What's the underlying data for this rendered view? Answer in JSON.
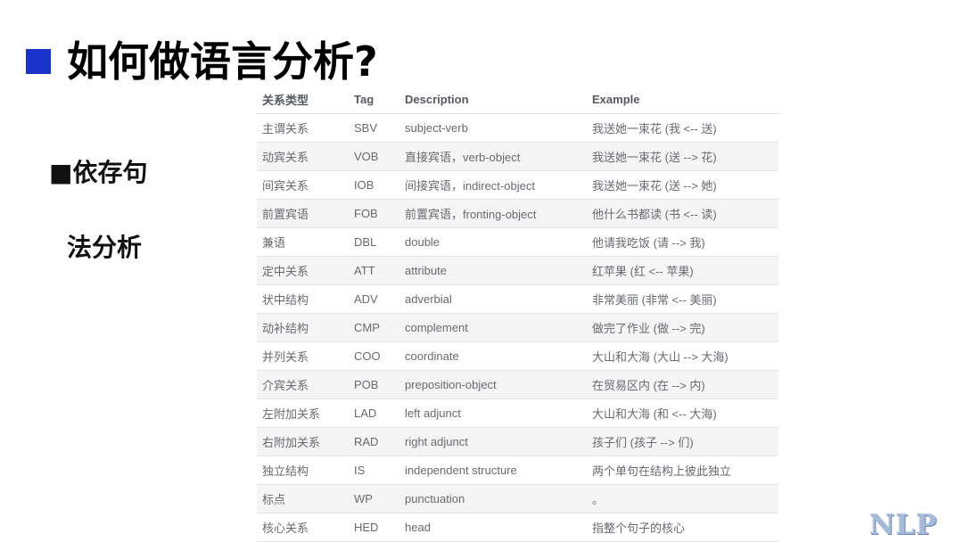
{
  "slide": {
    "title": "如何做语言分析?",
    "side_text_line1": "■依存句",
    "side_text_line2": "法分析",
    "accent_color": "#1a33c8",
    "logo": "NLP"
  },
  "table": {
    "headers": [
      "关系类型",
      "Tag",
      "Description",
      "Example"
    ],
    "rows": [
      [
        "主谓关系",
        "SBV",
        "subject-verb",
        "我送她一束花 (我 <-- 送)"
      ],
      [
        "动宾关系",
        "VOB",
        "直接宾语，verb-object",
        "我送她一束花 (送 --> 花)"
      ],
      [
        "间宾关系",
        "IOB",
        "间接宾语，indirect-object",
        "我送她一束花 (送 --> 她)"
      ],
      [
        "前置宾语",
        "FOB",
        "前置宾语，fronting-object",
        "他什么书都读 (书 <-- 读)"
      ],
      [
        "兼语",
        "DBL",
        "double",
        "他请我吃饭 (请 --> 我)"
      ],
      [
        "定中关系",
        "ATT",
        "attribute",
        "红苹果 (红 <-- 苹果)"
      ],
      [
        "状中结构",
        "ADV",
        "adverbial",
        "非常美丽 (非常 <-- 美丽)"
      ],
      [
        "动补结构",
        "CMP",
        "complement",
        "做完了作业 (做 --> 完)"
      ],
      [
        "并列关系",
        "COO",
        "coordinate",
        "大山和大海 (大山 --> 大海)"
      ],
      [
        "介宾关系",
        "POB",
        "preposition-object",
        "在贸易区内 (在 --> 内)"
      ],
      [
        "左附加关系",
        "LAD",
        "left adjunct",
        "大山和大海 (和 <-- 大海)"
      ],
      [
        "右附加关系",
        "RAD",
        "right adjunct",
        "孩子们 (孩子 --> 们)"
      ],
      [
        "独立结构",
        "IS",
        "independent structure",
        "两个单句在结构上彼此独立"
      ],
      [
        "标点",
        "WP",
        "punctuation",
        "。"
      ],
      [
        "核心关系",
        "HED",
        "head",
        "指整个句子的核心"
      ]
    ]
  }
}
